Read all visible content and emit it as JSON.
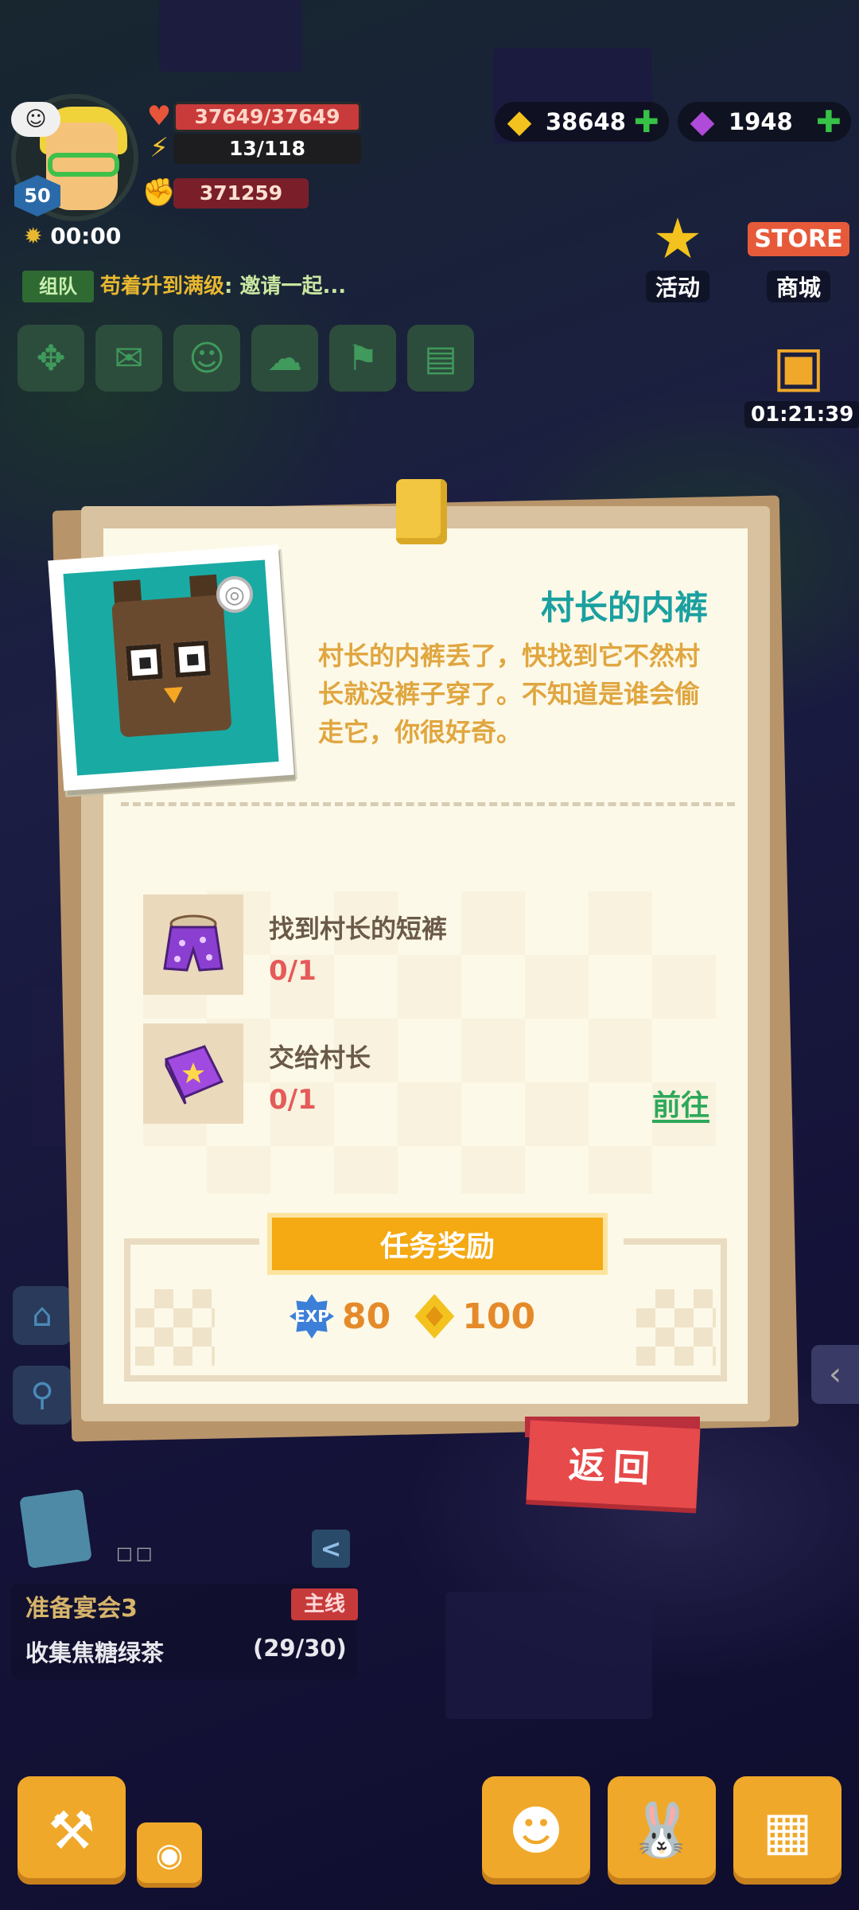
{
  "player": {
    "level": "50",
    "hp": "37649/37649",
    "energy": "13/118",
    "power": "371259",
    "timer": "00:00"
  },
  "team": {
    "tag": "组队",
    "message_highlight": "苟着升到满级",
    "message": ": 邀请一起..."
  },
  "currency": {
    "gold": "38648",
    "gems": "1948"
  },
  "top_buttons": {
    "events_label": "活动",
    "store_label": "商城",
    "store_sign": "STORE",
    "gift_countdown": "01:21:39"
  },
  "quest": {
    "title": "村长的内裤",
    "description": "村长的内裤丢了，快找到它不然村长就没裤子穿了。不知道是谁会偷走它，你很好奇。",
    "tasks": [
      {
        "name": "找到村长的短裤",
        "progress": "0/1"
      },
      {
        "name": "交给村长",
        "progress": "0/1"
      }
    ],
    "goto_label": "前往",
    "reward_title": "任务奖励",
    "rewards": {
      "exp_badge": "EXP",
      "exp": "80",
      "gold": "100"
    },
    "back_label": "返回"
  },
  "mission": {
    "title": "准备宴会3",
    "tag": "主线",
    "subtitle": "收集焦糖绿茶",
    "count": "(29/30)",
    "dots": "□□",
    "collapse_icon": "<"
  },
  "colors": {
    "quest_title": "#1aa0a0",
    "quest_desc": "#e0a640",
    "progress": "#e55a5a",
    "goto": "#2ea85a",
    "reward_banner": "#f5a912",
    "back_button": "#e64a4a"
  }
}
